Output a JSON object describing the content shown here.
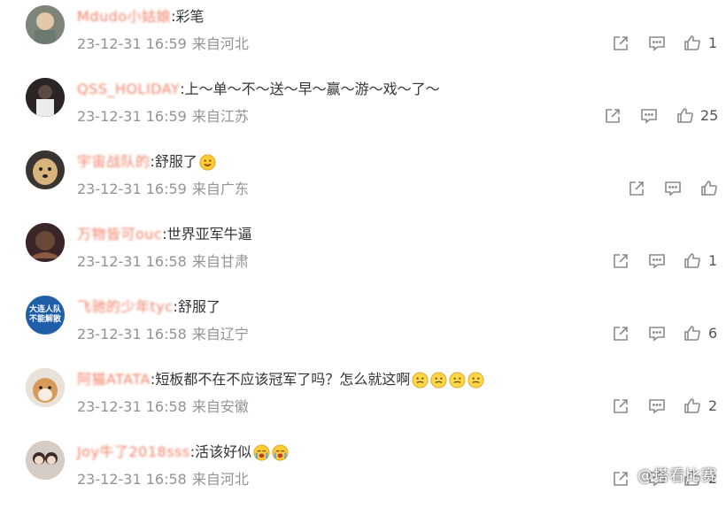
{
  "comments": [
    {
      "username": "Mdudo小姑娘",
      "text": ":彩笔",
      "time": "23-12-31 16:59",
      "location": "来自河北",
      "likes": "1",
      "avatar_color": "#8a8f86",
      "avatar_text": ""
    },
    {
      "username": "QSS_HOLIDAY",
      "text": ":上～单～不～送～早～赢～游～戏～了～",
      "time": "23-12-31 16:59",
      "location": "来自江苏",
      "likes": "25",
      "avatar_color": "#3a2a2a",
      "avatar_text": ""
    },
    {
      "username": "宇宙战队的",
      "text": ":舒服了",
      "time": "23-12-31 16:59",
      "location": "来自广东",
      "likes": "",
      "avatar_color": "#c9a878",
      "avatar_text": ""
    },
    {
      "username": "万物皆可ouc",
      "text": ":世界亚军牛逼",
      "time": "23-12-31 16:58",
      "location": "来自甘肃",
      "likes": "1",
      "avatar_color": "#4a3030",
      "avatar_text": ""
    },
    {
      "username": "飞驰的少年tyc",
      "text": ":舒服了",
      "time": "23-12-31 16:58",
      "location": "来自辽宁",
      "likes": "6",
      "avatar_color": "#1e5fa8",
      "avatar_text": "大连人队 不能解散"
    },
    {
      "username": "阿猫ATATA",
      "text": ":短板都不在不应该冠军了吗？怎么就这啊",
      "time": "23-12-31 16:58",
      "location": "来自安徽",
      "likes": "2",
      "avatar_color": "#d8b890",
      "avatar_text": ""
    },
    {
      "username": "Joy牛了2018sss",
      "text": ":活该好似",
      "time": "23-12-31 16:58",
      "location": "来自河北",
      "likes": "2",
      "avatar_color": "#b8a8a0",
      "avatar_text": ""
    }
  ],
  "watermark": "@塔看比赛",
  "colors": {
    "username": "#f06a4a",
    "meta": "#939393",
    "icon": "#8a8a8a"
  }
}
